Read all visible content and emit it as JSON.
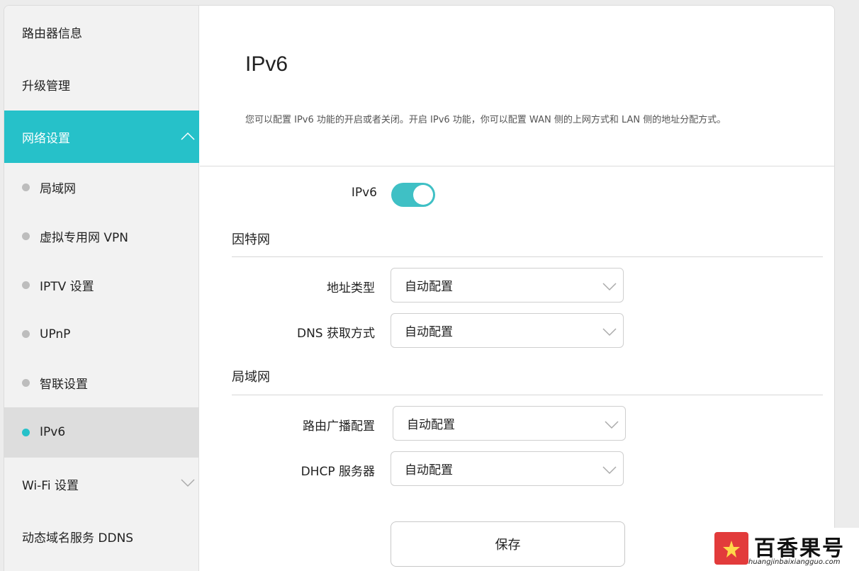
{
  "sidebar": {
    "items": [
      {
        "label": "路由器信息"
      },
      {
        "label": "升级管理"
      },
      {
        "label": "网络设置"
      },
      {
        "label": "局域网"
      },
      {
        "label": "虚拟专用网 VPN"
      },
      {
        "label": "IPTV 设置"
      },
      {
        "label": "UPnP"
      },
      {
        "label": "智联设置"
      },
      {
        "label": "IPv6"
      },
      {
        "label": "Wi-Fi 设置"
      },
      {
        "label": "动态域名服务 DDNS"
      }
    ]
  },
  "main": {
    "title": "IPv6",
    "description": "您可以配置 IPv6 功能的开启或者关闭。开启 IPv6 功能，你可以配置 WAN 侧的上网方式和 LAN 侧的地址分配方式。",
    "ipv6_toggle": {
      "label": "IPv6",
      "state": "on"
    },
    "internet_section": {
      "title": "因特网",
      "address_type": {
        "label": "地址类型",
        "value": "自动配置"
      },
      "dns_method": {
        "label": "DNS 获取方式",
        "value": "自动配置"
      }
    },
    "lan_section": {
      "title": "局域网",
      "route_advert": {
        "label": "路由广播配置",
        "value": "自动配置"
      },
      "dhcp_server": {
        "label": "DHCP 服务器",
        "value": "自动配置"
      }
    },
    "save_label": "保存"
  },
  "watermark": {
    "text": "百香果号",
    "url": "huangjinbaixiangguo.com"
  },
  "colors": {
    "accent": "#26c1c9",
    "toggle_on": "#3fc0c5",
    "sidebar_bg": "#f2f2f2",
    "selected_bg": "#dddddd"
  }
}
